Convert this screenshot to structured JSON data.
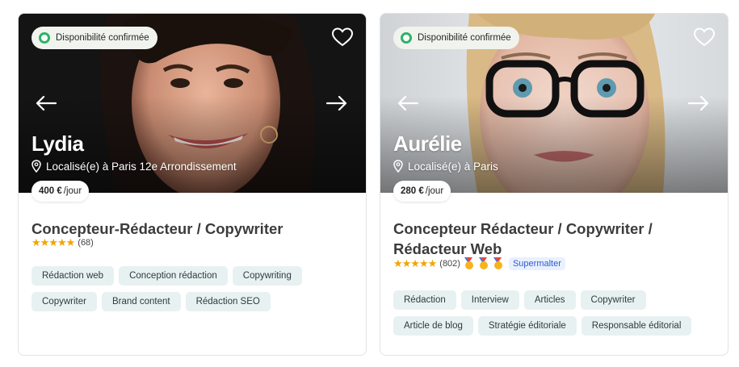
{
  "cards": [
    {
      "availability": "Disponibilité confirmée",
      "name": "Lydia",
      "location": "Localisé(e) à Paris 12e Arrondissement",
      "price_amount": "400 €",
      "price_unit": "/jour",
      "title": "Concepteur-Rédacteur / Copywriter",
      "rating_count": "(68)",
      "stars": "★★★★★",
      "tags": [
        "Rédaction web",
        "Conception rédaction",
        "Copywriting",
        "Copywriter",
        "Brand content",
        "Rédaction SEO"
      ]
    },
    {
      "availability": "Disponibilité confirmée",
      "name": "Aurélie",
      "location": "Localisé(e) à Paris",
      "price_amount": "280 €",
      "price_unit": "/jour",
      "title": "Concepteur Rédacteur / Copywriter / Rédacteur Web",
      "rating_count": "(802)",
      "stars": "★★★★★",
      "supermalter": "Supermalter",
      "tags": [
        "Rédaction",
        "Interview",
        "Articles",
        "Copywriter",
        "Article de blog",
        "Stratégie éditoriale",
        "Responsable éditorial"
      ]
    }
  ],
  "icons": {
    "favorite": "heart-outline-icon",
    "prev": "arrow-left-icon",
    "next": "arrow-right-icon",
    "location": "map-pin-icon",
    "availability": "green-dot-icon",
    "medal": "medal-icon"
  },
  "colors": {
    "availability_dot": "#2fb368",
    "star": "#f0a500",
    "tag_bg": "#e8f1f1",
    "supermalter": "#2e5cd1"
  }
}
